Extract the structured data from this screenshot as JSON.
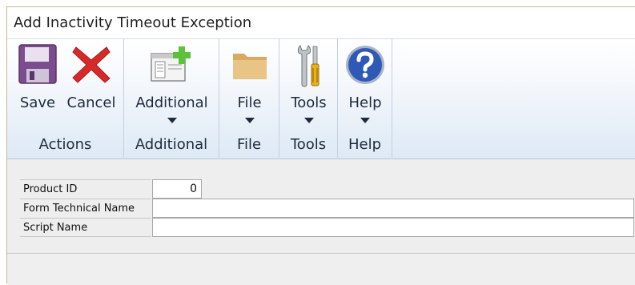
{
  "window": {
    "title": "Add Inactivity Timeout Exception"
  },
  "ribbon": {
    "groups": [
      {
        "label": "Actions",
        "buttons": [
          {
            "label": "Save",
            "icon": "save-icon"
          },
          {
            "label": "Cancel",
            "icon": "cancel-icon"
          }
        ]
      },
      {
        "label": "Additional",
        "buttons": [
          {
            "label": "Additional",
            "icon": "additional-icon",
            "dropdown": true
          }
        ]
      },
      {
        "label": "File",
        "buttons": [
          {
            "label": "File",
            "icon": "folder-icon",
            "dropdown": true
          }
        ]
      },
      {
        "label": "Tools",
        "buttons": [
          {
            "label": "Tools",
            "icon": "tools-icon",
            "dropdown": true
          }
        ]
      },
      {
        "label": "Help",
        "buttons": [
          {
            "label": "Help",
            "icon": "help-icon",
            "dropdown": true
          }
        ]
      }
    ]
  },
  "form": {
    "fields": [
      {
        "label": "Product ID",
        "value": "0"
      },
      {
        "label": "Form Technical Name",
        "value": ""
      },
      {
        "label": "Script Name",
        "value": ""
      }
    ]
  },
  "colors": {
    "ribbon_top": "#ffffff",
    "ribbon_bottom": "#dde9f5",
    "save_purple": "#7b4c8e",
    "cancel_red": "#d62a2a",
    "add_green": "#5cc23c",
    "folder_tan": "#e3bb7a",
    "help_blue": "#2f59b6"
  }
}
